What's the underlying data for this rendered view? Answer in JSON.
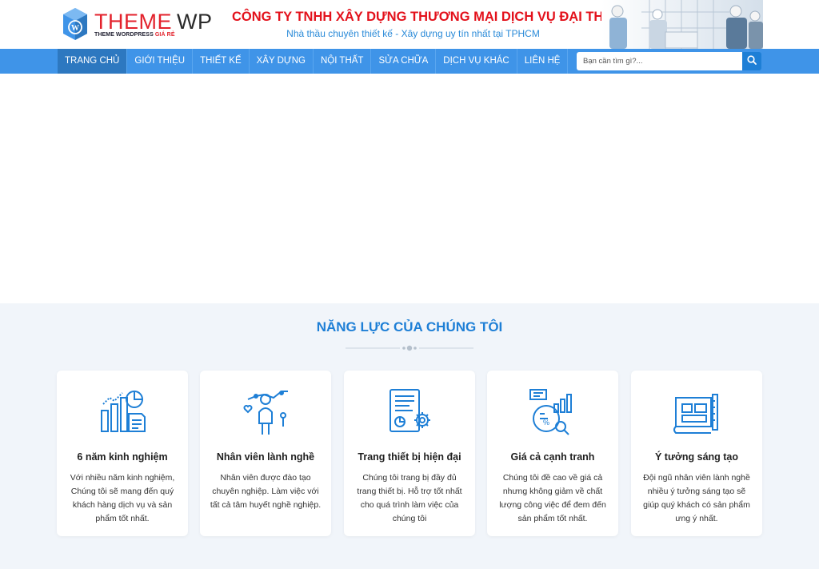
{
  "logo": {
    "main_part1": "THEME",
    "main_part2": "WP",
    "sub_part1": "THEME WORDPRESS ",
    "sub_part2": "GIÁ RẺ"
  },
  "company": {
    "name": "CÔNG TY TNHH XÂY DỰNG THƯƠNG MẠI DỊCH VỤ ĐẠI THANH",
    "tagline": "Nhà thầu chuyên thiết kế - Xây dựng uy tín nhất tại TPHCM"
  },
  "nav": {
    "items": [
      {
        "label": "TRANG CHỦ"
      },
      {
        "label": "GIỚI THIỆU"
      },
      {
        "label": "THIẾT KẾ"
      },
      {
        "label": "XÂY DỰNG"
      },
      {
        "label": "NỘI THẤT"
      },
      {
        "label": "SỬA CHỮA"
      },
      {
        "label": "DỊCH VỤ KHÁC"
      },
      {
        "label": "LIÊN HỆ"
      }
    ],
    "active_index": 0
  },
  "search": {
    "placeholder": "Bạn cần tìm gì?...",
    "value": ""
  },
  "features": {
    "title": "NĂNG LỰC CỦA CHÚNG TÔI",
    "cards": [
      {
        "icon": "chart-growth-icon",
        "title": "6 năm kinh nghiệm",
        "text": "Với nhiều năm kinh nghiệm, Chúng tôi sẽ mang đến quý khách hàng dịch vụ và sản phẩm tốt nhất."
      },
      {
        "icon": "employee-skills-icon",
        "title": "Nhân viên lành nghề",
        "text": "Nhân viên được đào tạo chuyên nghiệp. Làm việc với tất cả tâm huyết nghề nghiệp."
      },
      {
        "icon": "document-gear-icon",
        "title": "Trang thiết bị hiện đại",
        "text": "Chúng tôi trang bị đầy đủ trang thiết bị. Hỗ trợ tốt nhất cho quá trình làm việc của chúng tôi"
      },
      {
        "icon": "price-analysis-icon",
        "title": "Giá cả cạnh tranh",
        "text": "Chúng tôi đề cao về giá cả nhưng không giảm về chất lượng công việc để đem đến sản phẩm tốt nhất."
      },
      {
        "icon": "blueprint-icon",
        "title": "Ý tưởng sáng tạo",
        "text": "Đội ngũ nhân viên lành nghề nhiều ý tưởng sáng tạo sẽ giúp quý khách có sản phẩm ưng ý nhất."
      }
    ]
  },
  "colors": {
    "primary": "#3f94e8",
    "active_nav": "#2d78c0",
    "accent_red": "#e3111b",
    "title_blue": "#1e7fd6",
    "section_bg": "#f1f5fa"
  }
}
